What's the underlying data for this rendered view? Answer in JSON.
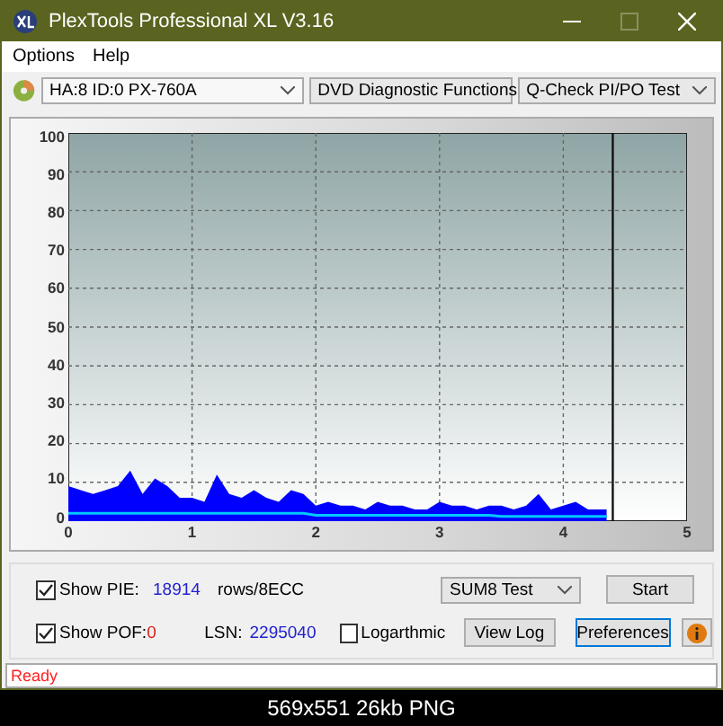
{
  "window": {
    "title": "PlexTools Professional XL V3.16"
  },
  "menu": [
    {
      "label": "Options"
    },
    {
      "label": "Help"
    }
  ],
  "toolbar": {
    "drive": "HA:8 ID:0  PX-760A",
    "function": "DVD Diagnostic Functions",
    "test": "Q-Check PI/PO Test"
  },
  "chart": {
    "chart_data": {
      "type": "area",
      "xlim": [
        0,
        5
      ],
      "ylim": [
        0,
        100
      ],
      "xticks": [
        0,
        1,
        2,
        3,
        4,
        5
      ],
      "yticks": [
        0,
        10,
        20,
        30,
        40,
        50,
        60,
        70,
        80,
        90,
        100
      ],
      "x": [
        0,
        0.1,
        0.2,
        0.3,
        0.4,
        0.5,
        0.6,
        0.7,
        0.8,
        0.9,
        1,
        1.1,
        1.2,
        1.3,
        1.4,
        1.5,
        1.6,
        1.7,
        1.8,
        1.9,
        2,
        2.1,
        2.2,
        2.3,
        2.4,
        2.5,
        2.6,
        2.7,
        2.8,
        2.9,
        3,
        3.1,
        3.2,
        3.3,
        3.4,
        3.5,
        3.6,
        3.7,
        3.8,
        3.9,
        4,
        4.1,
        4.2,
        4.3,
        4.35
      ],
      "series": [
        {
          "type": "area",
          "color": "#0000ff",
          "values": [
            9,
            8,
            7,
            8,
            9,
            13,
            7,
            11,
            9,
            6,
            6,
            5,
            12,
            7,
            6,
            8,
            6,
            5,
            8,
            7,
            4,
            5,
            4,
            4,
            3,
            5,
            4,
            4,
            3,
            3,
            5,
            4,
            4,
            3,
            4,
            4,
            3,
            4,
            7,
            3,
            4,
            5,
            3,
            3,
            3
          ]
        },
        {
          "type": "line",
          "color": "#00c8ff",
          "values": [
            2,
            2,
            2,
            2,
            2,
            2,
            2,
            2,
            2,
            2,
            2,
            2,
            2,
            2,
            2,
            2,
            2,
            2,
            2,
            2,
            1.5,
            1.5,
            1.5,
            1.5,
            1.5,
            1.5,
            1.5,
            1.5,
            1.5,
            1.5,
            1.5,
            1.5,
            1.5,
            1.5,
            1.5,
            1.2,
            1.2,
            1.2,
            1.2,
            1.2,
            1.2,
            1.2,
            1.2,
            1.2,
            1.2
          ]
        }
      ],
      "grid": true,
      "ref_lines": [
        {
          "axis": "x",
          "value": 4.4
        }
      ]
    }
  },
  "controls": {
    "show_pie": {
      "label": "Show PIE:",
      "checked": true,
      "value": "18914",
      "unit": "rows/8ECC"
    },
    "show_pof": {
      "label": "Show POF:",
      "checked": true,
      "value": "0"
    },
    "lsn": {
      "label": "LSN:",
      "value": "2295040"
    },
    "logarithmic": {
      "label": "Logarthmic",
      "checked": false
    },
    "test_select": "SUM8 Test",
    "buttons": [
      {
        "label": "Start",
        "focused": false
      },
      {
        "label": "View Log",
        "focused": false
      },
      {
        "label": "Preferences",
        "focused": true
      }
    ]
  },
  "status_bar": "Ready",
  "caption": "569x551 26kb PNG"
}
